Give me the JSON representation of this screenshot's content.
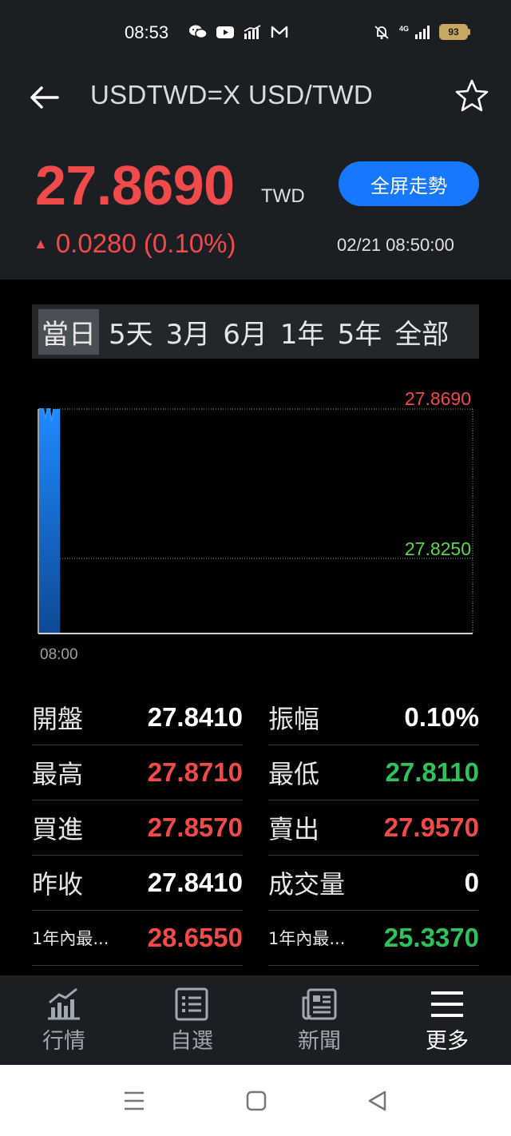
{
  "status_bar": {
    "time": "08:53",
    "network": "4G",
    "battery": "93",
    "icons": [
      "wechat-icon",
      "youtube-icon",
      "chart-icon",
      "mail-icon",
      "mute-icon",
      "signal-icon",
      "battery-icon"
    ]
  },
  "header": {
    "title": "USDTWD=X USD/TWD",
    "price": "27.8690",
    "currency": "TWD",
    "fullscreen_label": "全屏走勢",
    "change": "0.0280 (0.10%)",
    "timestamp": "02/21 08:50:00"
  },
  "tabs": [
    "當日",
    "5天",
    "3月",
    "6月",
    "1年",
    "5年",
    "全部"
  ],
  "active_tab": "當日",
  "chart_data": {
    "type": "area",
    "x_start_label": "08:00",
    "top_label": "27.8690",
    "mid_label": "27.8250",
    "ylim": [
      27.781,
      27.869
    ],
    "points": [
      {
        "y": 27.869
      },
      {
        "y": 27.869
      },
      {
        "y": 27.869
      },
      {
        "y": 27.865
      },
      {
        "y": 27.869
      },
      {
        "y": 27.869
      },
      {
        "y": 27.864
      },
      {
        "y": 27.869
      }
    ],
    "colors": {
      "fill": "#1f6fd0",
      "top_label": "#f04a4a",
      "mid_label": "#58d84a"
    }
  },
  "stats": [
    {
      "left_label": "開盤",
      "left_value": "27.8410",
      "left_color": "white",
      "right_label": "振幅",
      "right_value": "0.10%",
      "right_color": "white"
    },
    {
      "left_label": "最高",
      "left_value": "27.8710",
      "left_color": "red",
      "right_label": "最低",
      "right_value": "27.8110",
      "right_color": "green"
    },
    {
      "left_label": "買進",
      "left_value": "27.8570",
      "left_color": "red",
      "right_label": "賣出",
      "right_value": "27.9570",
      "right_color": "red"
    },
    {
      "left_label": "昨收",
      "left_value": "27.8410",
      "left_color": "white",
      "right_label": "成交量",
      "right_value": "0",
      "right_color": "white"
    },
    {
      "left_label": "1年內最...",
      "left_value": "28.6550",
      "left_color": "red",
      "right_label": "1年內最...",
      "right_value": "25.3370",
      "right_color": "green"
    }
  ],
  "bottom_nav": [
    {
      "label": "行情",
      "icon": "market-chart-icon",
      "active": false
    },
    {
      "label": "自選",
      "icon": "watchlist-icon",
      "active": false
    },
    {
      "label": "新聞",
      "icon": "news-icon",
      "active": false
    },
    {
      "label": "更多",
      "icon": "menu-icon",
      "active": true
    }
  ],
  "colors": {
    "up": "#f04a4a",
    "down": "#2fc15c",
    "accent": "#1677ff"
  }
}
